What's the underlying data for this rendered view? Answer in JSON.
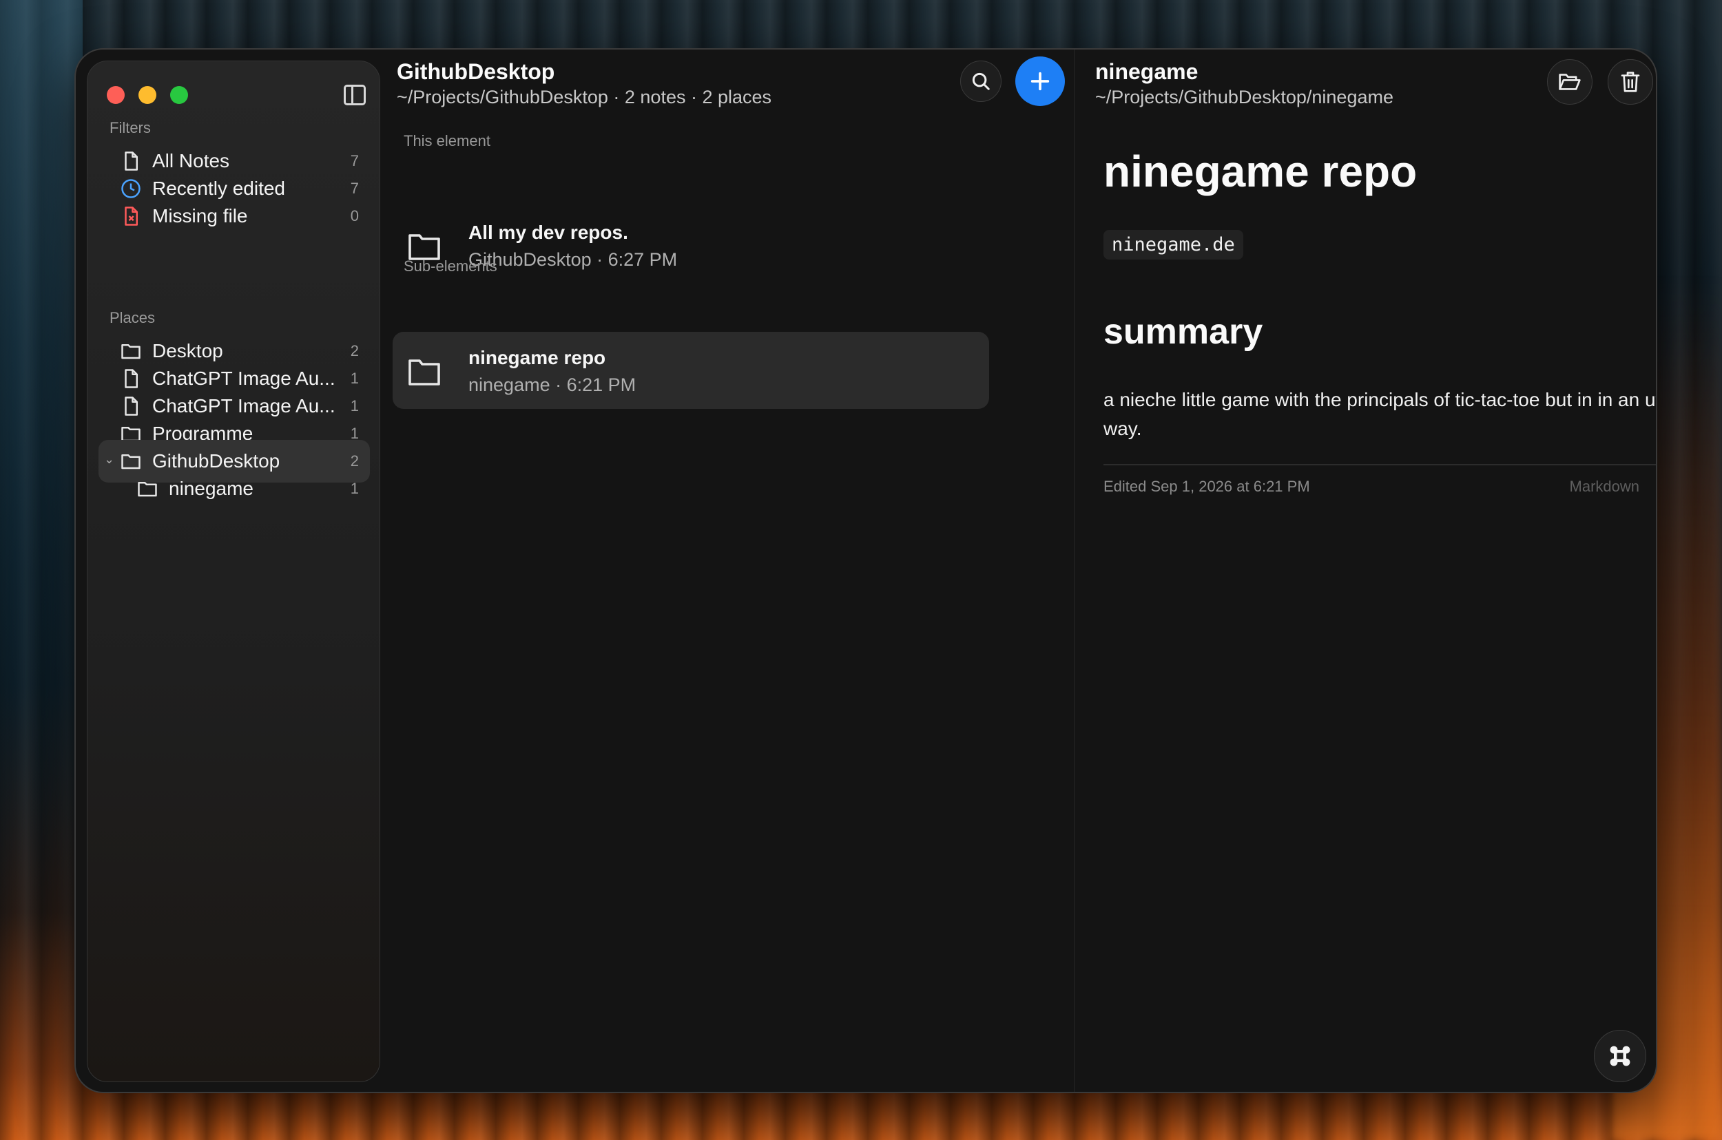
{
  "sidebar": {
    "filters_label": "Filters",
    "filters": [
      {
        "label": "All Notes",
        "count": "7",
        "icon": "file-icon"
      },
      {
        "label": "Recently edited",
        "count": "7",
        "icon": "clock-icon"
      },
      {
        "label": "Missing file",
        "count": "0",
        "icon": "missing-file-icon"
      }
    ],
    "places_label": "Places",
    "places": [
      {
        "label": "Desktop",
        "count": "2",
        "icon": "folder-icon"
      },
      {
        "label": "ChatGPT Image Au...",
        "count": "1",
        "icon": "file-icon"
      },
      {
        "label": "ChatGPT Image Au...",
        "count": "1",
        "icon": "file-icon"
      },
      {
        "label": "Programme",
        "count": "1",
        "icon": "folder-icon"
      },
      {
        "label": "GithubDesktop",
        "count": "2",
        "icon": "folder-icon"
      },
      {
        "label": "ninegame",
        "count": "1",
        "icon": "folder-icon"
      }
    ]
  },
  "middle": {
    "title": "GithubDesktop",
    "subtitle": "~/Projects/GithubDesktop · 2 notes · 2 places",
    "this_element_label": "This element",
    "this_element": {
      "title": "All my dev repos.",
      "meta": "GithubDesktop · 6:27 PM"
    },
    "sub_elements_label": "Sub-elements",
    "sub_elements": [
      {
        "title": "ninegame repo",
        "meta": "ninegame · 6:21 PM"
      }
    ]
  },
  "detail": {
    "title": "ninegame",
    "path": "~/Projects/GithubDesktop/ninegame",
    "heading": "ninegame repo",
    "link": "ninegame.de",
    "section_heading": "summary",
    "body": "a nieche little game with the principals of tic-tac-toe but in in an utimate way.",
    "edited": "Edited Sep 1, 2026 at 6:21 PM",
    "format": "Markdown"
  },
  "colors": {
    "accent": "#1e7ff5",
    "close": "#fe5f57",
    "minimize": "#febc2e",
    "maximize": "#28c840",
    "clock": "#4aa3ff",
    "missing": "#ff5a5a"
  }
}
